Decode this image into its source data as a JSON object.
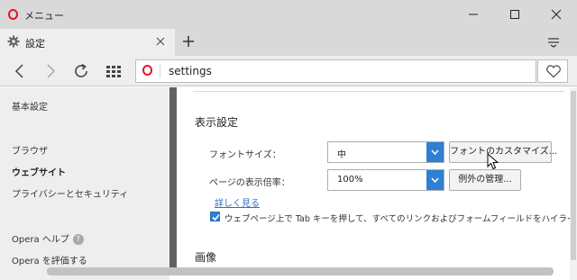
{
  "window": {
    "title": "メニュー"
  },
  "tab": {
    "label": "設定"
  },
  "address": {
    "url": "settings"
  },
  "sidebar": {
    "items": [
      {
        "label": "基本設定"
      },
      {
        "label": "ブラウザ"
      },
      {
        "label": "ウェブサイト"
      },
      {
        "label": "プライバシーとセキュリティ"
      },
      {
        "label": "Opera ヘルプ"
      },
      {
        "label": "Opera を評価する"
      }
    ],
    "active": "ウェブサイト"
  },
  "content": {
    "display_section": {
      "title": "表示設定",
      "font_size": {
        "label": "フォントサイズ：",
        "value": "中",
        "button": "フォントのカスタマイズ..."
      },
      "zoom": {
        "label": "ページの表示倍率：",
        "value": "100%",
        "button": "例外の管理..."
      },
      "details_link": "詳しく見る",
      "tab_highlight": {
        "label": "ウェブページ上で Tab キーを押して、すべてのリンクおよびフォームフィールドをハイライトする",
        "checked": true
      }
    },
    "images_section": {
      "title": "画像"
    }
  },
  "colors": {
    "brand": "#e0162b",
    "accent": "#2f7fd4"
  },
  "icons": [
    "opera-logo-icon",
    "gear-icon",
    "close-icon",
    "plus-icon",
    "menu-icon",
    "back-icon",
    "forward-icon",
    "reload-icon",
    "speed-dial-icon",
    "heart-icon",
    "help-icon",
    "chevron-down-icon",
    "checkmark-icon",
    "mouse-cursor-icon"
  ]
}
